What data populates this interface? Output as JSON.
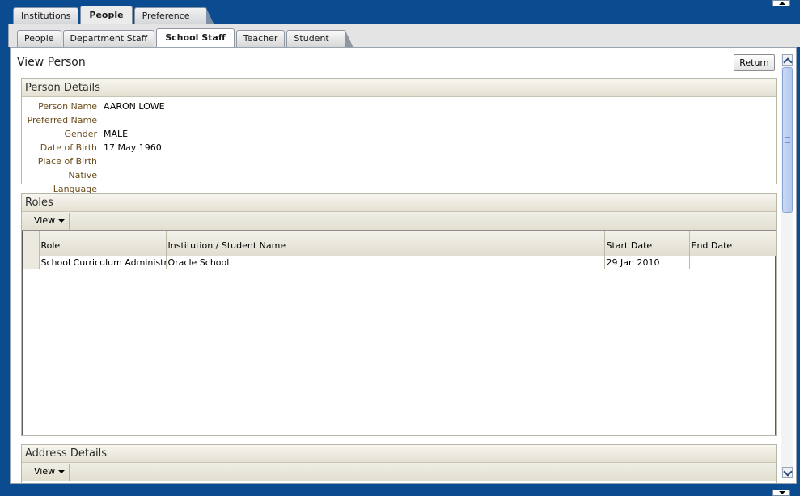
{
  "tabs_level1": [
    {
      "label": "Institutions",
      "active": false
    },
    {
      "label": "People",
      "active": true
    },
    {
      "label": "Preference",
      "active": false
    }
  ],
  "tabs_level2": [
    {
      "label": "People",
      "active": false
    },
    {
      "label": "Department Staff",
      "active": false
    },
    {
      "label": "School Staff",
      "active": true
    },
    {
      "label": "Teacher",
      "active": false
    },
    {
      "label": "Student",
      "active": false
    }
  ],
  "page": {
    "title": "View Person",
    "return_label": "Return"
  },
  "person_details": {
    "header": "Person Details",
    "fields": [
      {
        "label": "Person Name",
        "value": "AARON LOWE"
      },
      {
        "label": "Preferred Name",
        "value": ""
      },
      {
        "label": "Gender",
        "value": "MALE"
      },
      {
        "label": "Date of Birth",
        "value": "17 May 1960"
      },
      {
        "label": "Place of Birth",
        "value": ""
      },
      {
        "label": "Native Language",
        "value": ""
      }
    ]
  },
  "roles": {
    "header": "Roles",
    "view_label": "View",
    "columns": [
      "Role",
      "Institution / Student Name",
      "Start Date",
      "End Date"
    ],
    "rows": [
      [
        "School Curriculum Administrator",
        "Oracle School",
        "29 Jan 2010",
        ""
      ]
    ]
  },
  "address_details": {
    "header": "Address Details",
    "view_label": "View"
  },
  "colors": {
    "frame_blue": "#0b4b8f",
    "label_brown": "#6b4c1a",
    "section_header_bg": "#e4e1d2"
  }
}
